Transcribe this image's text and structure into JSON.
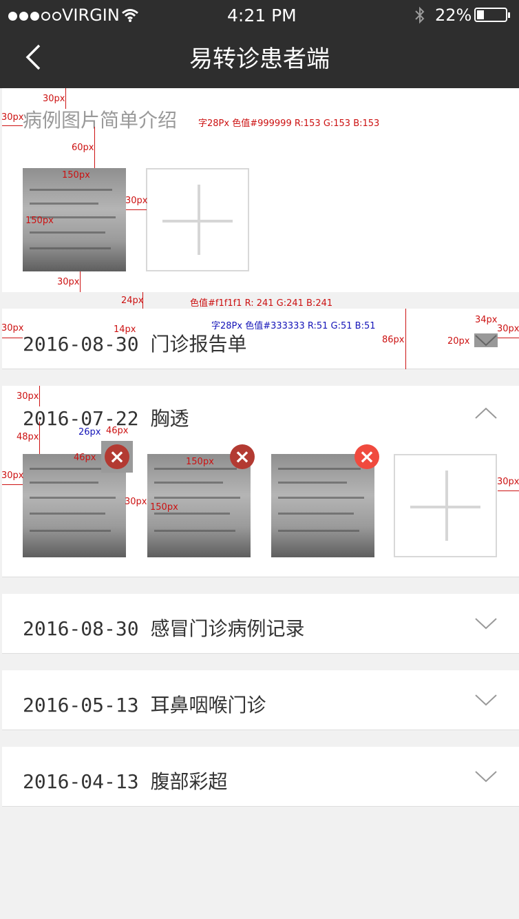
{
  "status_bar": {
    "carrier": "VIRGIN",
    "time": "4:21 PM",
    "battery": "22%"
  },
  "nav": {
    "title": "易转诊患者端"
  },
  "intro": {
    "title": "病例图片简单介绍"
  },
  "records": [
    {
      "date": "2016-08-30",
      "name": "门诊报告单",
      "expanded": false
    },
    {
      "date": "2016-07-22",
      "name": "胸透",
      "expanded": true
    },
    {
      "date": "2016-08-30",
      "name": "感冒门诊病例记录",
      "expanded": false
    },
    {
      "date": "2016-05-13",
      "name": "耳鼻咽喉门诊",
      "expanded": false
    },
    {
      "date": "2016-04-13",
      "name": "腹部彩超",
      "expanded": false
    }
  ],
  "annotations": {
    "px30": "30px",
    "px60": "60px",
    "px150": "150px",
    "px24": "24px",
    "px14": "14px",
    "px34": "34px",
    "px20": "20px",
    "px86": "86px",
    "px48": "48px",
    "px26": "26px",
    "px46": "46px",
    "note_intro": "字28Px 色值#999999 R:153 G:153  B:153",
    "note_bg": "色值#f1f1f1  R: 241 G:241  B:241",
    "note_row": "字28Px 色值#333333 R:51 G:51   B:51"
  },
  "colors": {
    "nav_bg": "#2e2e2e",
    "page_bg": "#f1f1f1",
    "intro_text": "#999999",
    "row_text": "#333333",
    "delete_red": "#f04a3e"
  },
  "icons": [
    "back-chevron-icon",
    "wifi-icon",
    "bluetooth-icon",
    "battery-icon",
    "plus-icon",
    "close-icon",
    "chevron-down-icon",
    "chevron-up-icon"
  ]
}
